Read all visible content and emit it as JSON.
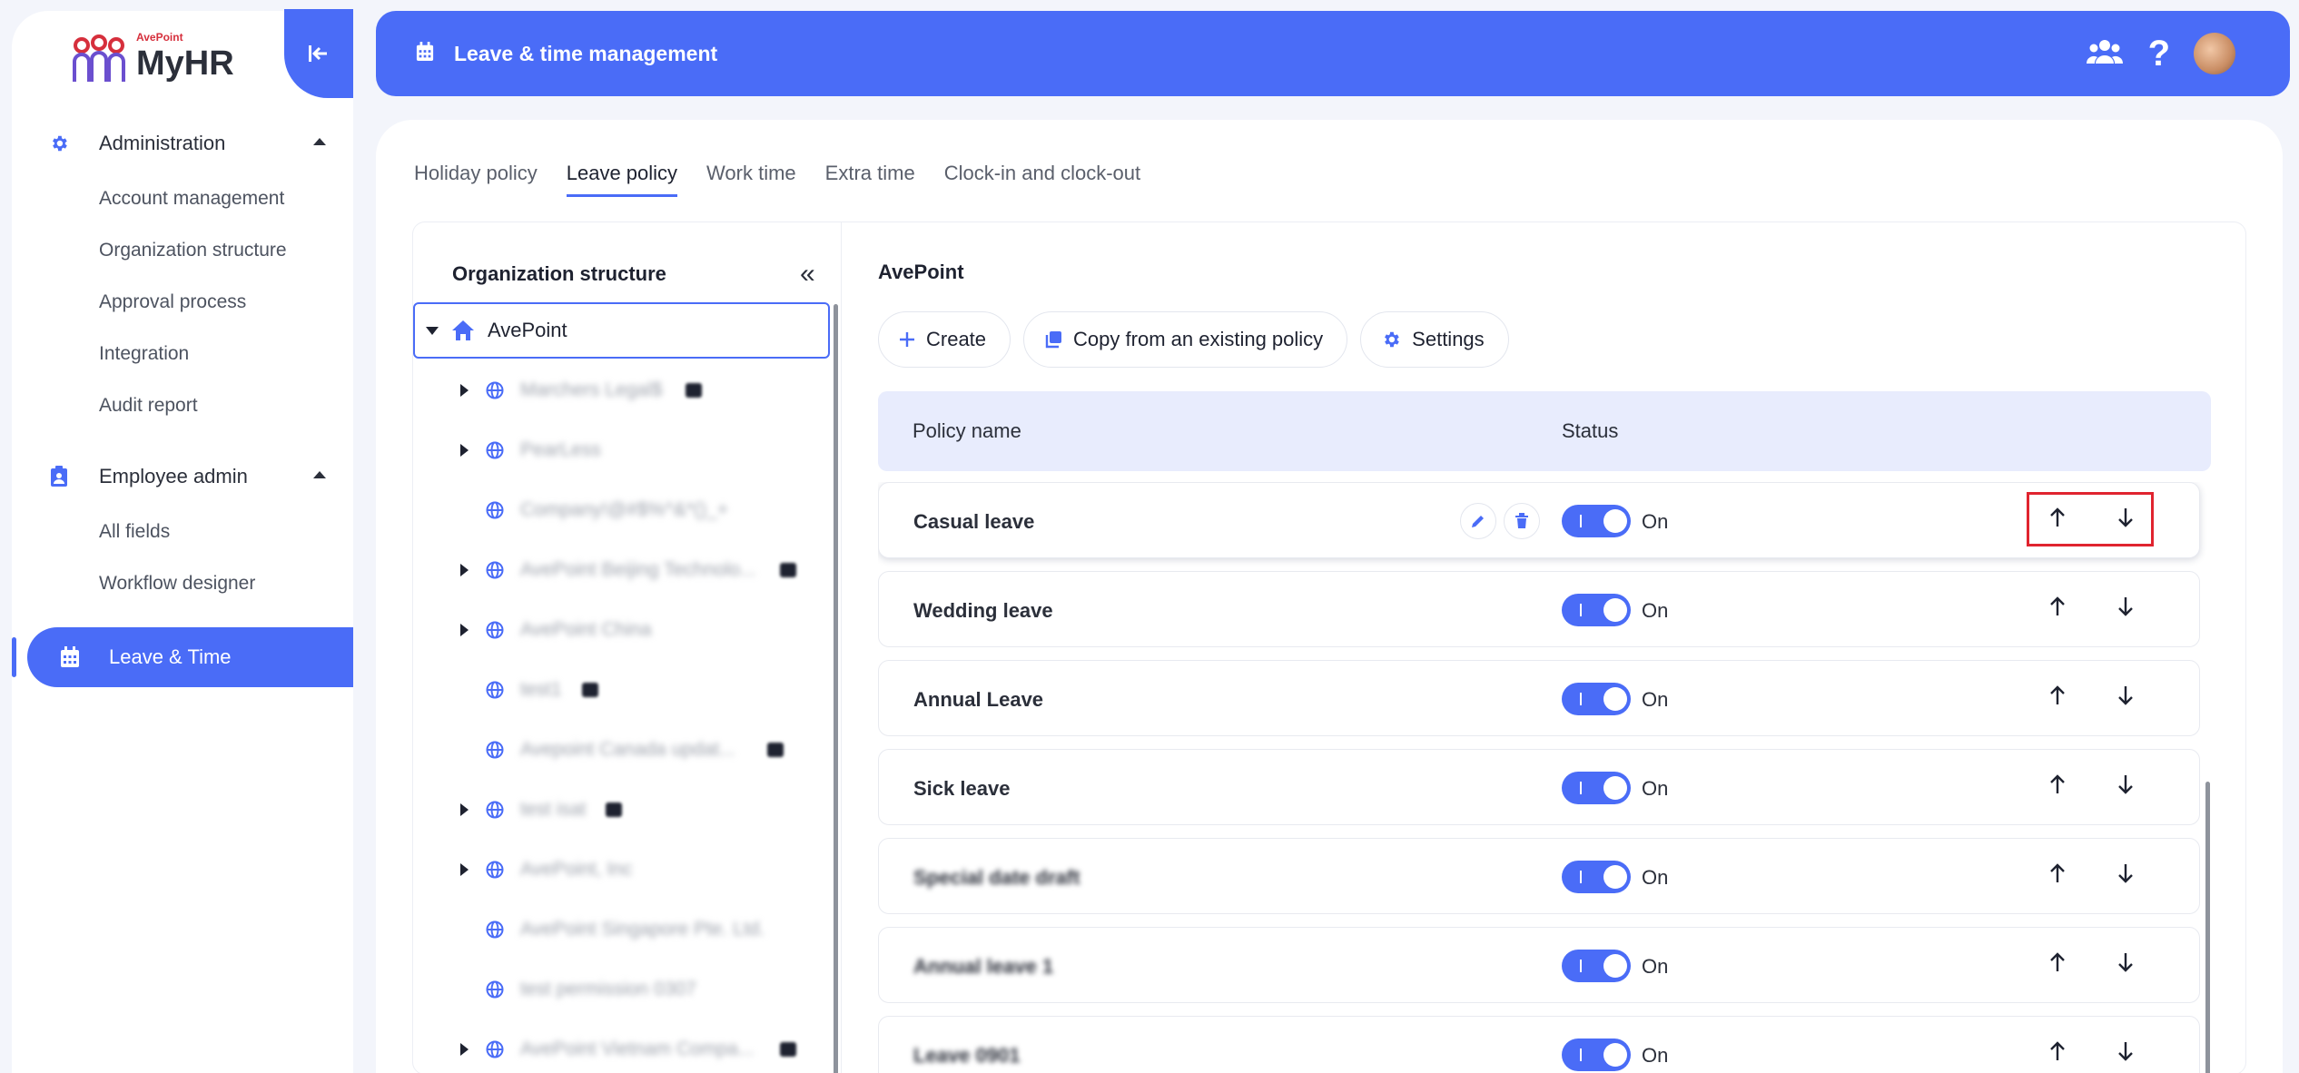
{
  "app": {
    "brand_sub": "AvePoint",
    "brand_name": "MyHR"
  },
  "sidebar": {
    "groups": [
      {
        "label": "Administration",
        "items": [
          "Account management",
          "Organization structure",
          "Approval process",
          "Integration",
          "Audit report"
        ]
      },
      {
        "label": "Employee admin",
        "items": [
          "All fields",
          "Workflow designer"
        ]
      }
    ],
    "active_item": "Leave & Time"
  },
  "topbar": {
    "title": "Leave & time management"
  },
  "tabs": [
    "Holiday policy",
    "Leave policy",
    "Work time",
    "Extra time",
    "Clock-in and clock-out"
  ],
  "active_tab": "Leave policy",
  "tree": {
    "title": "Organization structure",
    "root": "AvePoint",
    "children": [
      {
        "label": "Marchers Legal$",
        "expandable": true,
        "lock": true
      },
      {
        "label": "PearLess",
        "expandable": true,
        "lock": false
      },
      {
        "label": "Company!@#$%^&*()_+",
        "expandable": false,
        "lock": false
      },
      {
        "label": "AvePoint Beijing Technolo...",
        "expandable": true,
        "lock": true
      },
      {
        "label": "AvePoint China",
        "expandable": true,
        "lock": false
      },
      {
        "label": "test1",
        "expandable": false,
        "lock": true
      },
      {
        "label": "Avepoint Canada updat...",
        "expandable": false,
        "lock": true
      },
      {
        "label": "test isat",
        "expandable": true,
        "lock": true
      },
      {
        "label": "AvePoint, Inc",
        "expandable": true,
        "lock": false
      },
      {
        "label": "AvePoint Singapore Pte. Ltd.",
        "expandable": false,
        "lock": false
      },
      {
        "label": "test permission 0307",
        "expandable": false,
        "lock": false
      },
      {
        "label": "AvePoint Vietnam Compa...",
        "expandable": true,
        "lock": true
      }
    ]
  },
  "policy": {
    "org_name": "AvePoint",
    "buttons": {
      "create": "Create",
      "copy": "Copy from an existing policy",
      "settings": "Settings"
    },
    "columns": {
      "name": "Policy name",
      "status": "Status"
    },
    "rows": [
      {
        "name": "Casual leave",
        "status": "On",
        "blurred": false,
        "highlighted": true
      },
      {
        "name": "Wedding leave",
        "status": "On",
        "blurred": false,
        "highlighted": false
      },
      {
        "name": "Annual Leave",
        "status": "On",
        "blurred": false,
        "highlighted": false
      },
      {
        "name": "Sick leave",
        "status": "On",
        "blurred": false,
        "highlighted": false
      },
      {
        "name": "Special date draft",
        "status": "On",
        "blurred": true,
        "highlighted": false
      },
      {
        "name": "Annual leave 1",
        "status": "On",
        "blurred": true,
        "highlighted": false
      },
      {
        "name": "Leave 0901",
        "status": "On",
        "blurred": true,
        "highlighted": false
      }
    ]
  },
  "colors": {
    "accent": "#4a6cf7",
    "header_row": "#e8ecfd",
    "highlight_box": "#e0242f"
  }
}
